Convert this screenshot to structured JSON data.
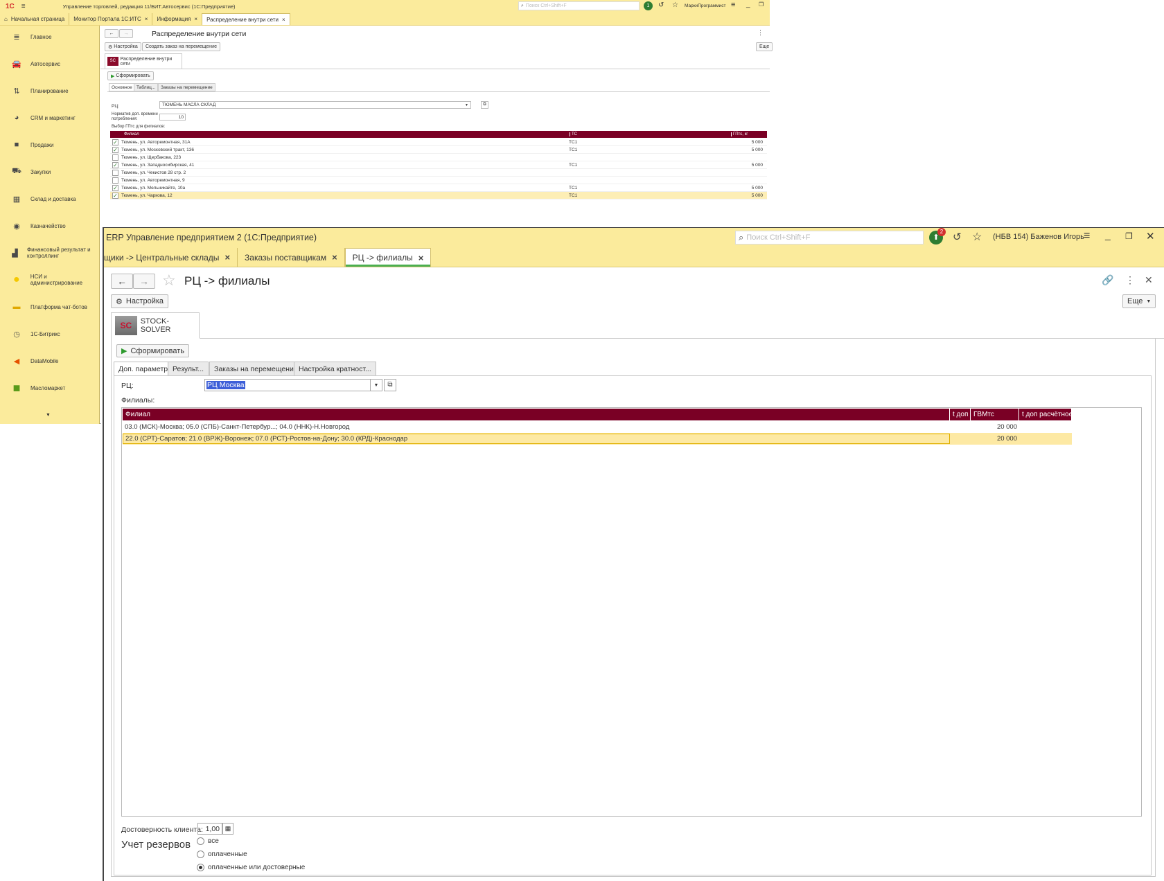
{
  "back_window": {
    "title": "Управление торговлей, редакция 11/БИТ.Автосервис  (1С:Предприятие)",
    "search_placeholder": "Поиск Ctrl+Shift+F",
    "notification_count": "1",
    "user": "МаркиПрограммист",
    "tabs": [
      {
        "label": "Начальная страница"
      },
      {
        "label": "Монитор Портала 1С:ИТС"
      },
      {
        "label": "Информация"
      },
      {
        "label": "Распределение внутри сети"
      }
    ],
    "sidebar": [
      {
        "label": "Главное",
        "icon": "menu-icon"
      },
      {
        "label": "Автосервис",
        "icon": "car-icon"
      },
      {
        "label": "Планирование",
        "icon": "planning-icon"
      },
      {
        "label": "CRM и маркетинг",
        "icon": "pie-icon"
      },
      {
        "label": "Продажи",
        "icon": "bag-icon"
      },
      {
        "label": "Закупки",
        "icon": "cart-icon"
      },
      {
        "label": "Склад и доставка",
        "icon": "grid-icon"
      },
      {
        "label": "Казначейство",
        "icon": "coin-icon"
      },
      {
        "label": "Финансовый результат и контроллинг",
        "icon": "chart-icon"
      },
      {
        "label": "НСИ и администрирование",
        "icon": "circle-icon"
      },
      {
        "label": "Платформа чат-ботов",
        "icon": "folder-icon"
      },
      {
        "label": "1С-Битрикс",
        "icon": "bitrix-icon"
      },
      {
        "label": "DataMobile",
        "icon": "datamobile-icon"
      },
      {
        "label": "Масломаркет",
        "icon": "gift-icon"
      }
    ],
    "page_title": "Распределение внутри сети",
    "btn_settings": "Настройка",
    "btn_create_order": "Создать заказ на перемещение",
    "btn_more": "Еще",
    "report_tab": "Распределение внутри сети",
    "btn_generate": "Сформировать",
    "subtabs": [
      "Основное",
      "Таблиц...",
      "Заказы на перемещение"
    ],
    "rc_label": "РЦ:",
    "rc_value": "ТЮМЕНЬ МАСЛА СКЛАД",
    "norm_label": "Норматив доп. времени потребления:",
    "norm_value": "10",
    "selection_label": "Выбор ГПтс для филиалов:",
    "columns": [
      "Филиал",
      "ТС",
      "ГПтс, кг"
    ],
    "rows": [
      {
        "checked": true,
        "branch": "Тюмень, ул. Авторемонтная, 31А",
        "tc": "ТС1",
        "value": "5 000"
      },
      {
        "checked": true,
        "branch": "Тюмень, ул. Московский тракт, 136",
        "tc": "ТС1",
        "value": "5 000"
      },
      {
        "checked": false,
        "branch": "Тюмень, ул. Щербакова, 223",
        "tc": "",
        "value": ""
      },
      {
        "checked": true,
        "branch": "Тюмень, ул. Западносибирская, 41",
        "tc": "ТС1",
        "value": "5 000"
      },
      {
        "checked": false,
        "branch": "Тюмень, ул. Чекистов 28 стр. 2",
        "tc": "",
        "value": ""
      },
      {
        "checked": false,
        "branch": "Тюмень, ул. Авторемонтная, 9",
        "tc": "",
        "value": ""
      },
      {
        "checked": true,
        "branch": "Тюмень, ул. Мельникайте, 10а",
        "tc": "ТС1",
        "value": "5 000"
      },
      {
        "checked": true,
        "branch": "Тюмень, ул. Чаркова, 12",
        "tc": "ТС1",
        "value": "5 000"
      }
    ]
  },
  "front_window": {
    "title": "ERP Управление предприятием 2  (1С:Предприятие)",
    "search_placeholder": "Поиск Ctrl+Shift+F",
    "notification_count": "2",
    "user": "(НБВ 154) Баженов Игорь",
    "tabs": [
      {
        "label": "щики -> Центральные склады"
      },
      {
        "label": "Заказы поставщикам"
      },
      {
        "label": "РЦ -> филиалы"
      }
    ],
    "page_title": "РЦ -> филиалы",
    "btn_settings": "Настройка",
    "btn_more": "Еще",
    "report_tab": "STOCK-SOLVER",
    "btn_generate": "Сформировать",
    "subtabs": [
      "Доп. параметры",
      "Результ...",
      "Заказы на перемещение",
      "Настройка кратност..."
    ],
    "rc_label": "РЦ:",
    "rc_value": "РЦ Москва",
    "branches_label": "Филиалы:",
    "columns": [
      "Филиал",
      "t доп",
      "ГВМтс",
      "t доп расчётное"
    ],
    "rows": [
      {
        "branch": "03.0 (МСК)-Москва; 05.0 (СПБ)-Санкт-Петербур...; 04.0 (ННК)-Н.Новгород",
        "t_dop": "",
        "gvm": "20 000",
        "t_calc": ""
      },
      {
        "branch": "22.0 (СРТ)-Саратов; 21.0 (ВРЖ)-Воронеж; 07.0 (РСТ)-Ростов-на-Дону; 30.0 (КРД)-Краснодар",
        "t_dop": "",
        "gvm": "20 000",
        "t_calc": ""
      }
    ],
    "reliability_label": "Достоверность клиента:",
    "reliability_value": "1,00",
    "reserves_label": "Учет резервов",
    "reserve_options": [
      "все",
      "оплаченные",
      "оплаченные или достоверные"
    ],
    "reserve_selected": "оплаченные или достоверные"
  },
  "colors": {
    "header_bar": "#fbeb9c",
    "table_header": "#7a0025",
    "selected_row": "#fde9a4",
    "accent_green": "#4caf50"
  }
}
